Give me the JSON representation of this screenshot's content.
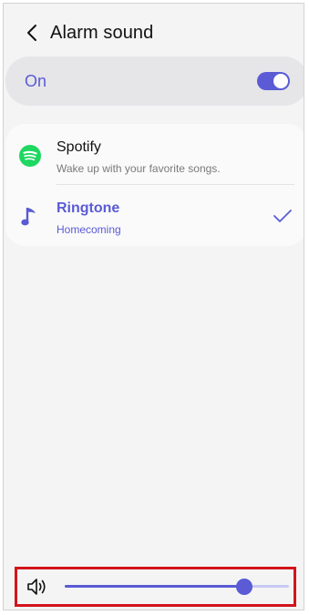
{
  "header": {
    "title": "Alarm sound",
    "back_icon": "chevron-left-icon"
  },
  "master_toggle": {
    "label": "On",
    "state": true
  },
  "sound_options": [
    {
      "title": "Spotify",
      "subtitle": "Wake up with your favorite songs.",
      "icon": "spotify-icon",
      "selected": false
    },
    {
      "title": "Ringtone",
      "subtitle": "Homecoming",
      "icon": "music-note-icon",
      "selected": true
    }
  ],
  "volume": {
    "icon": "speaker-icon",
    "level": 0.8
  },
  "colors": {
    "accent": "#5a5bd5",
    "spotify_green": "#1ed760",
    "highlight_box": "#d3141b"
  }
}
